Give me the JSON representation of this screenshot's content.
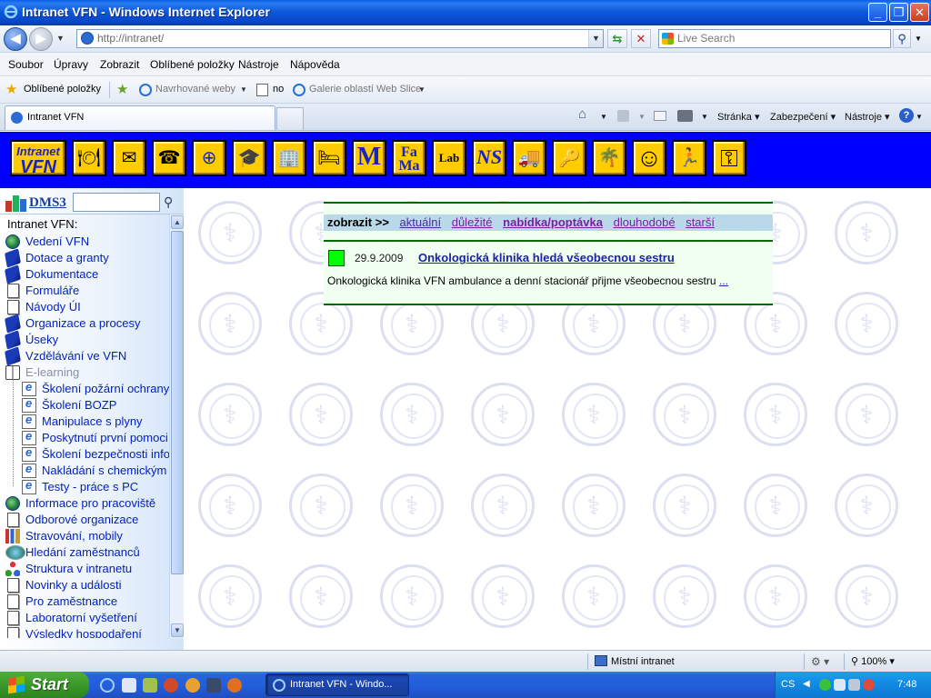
{
  "window": {
    "title": "Intranet VFN - Windows Internet Explorer"
  },
  "address": {
    "url": "http://intranet/",
    "search_placeholder": "Live Search"
  },
  "menu": [
    "Soubor",
    "Úpravy",
    "Zobrazit",
    "Oblíbené položky",
    "Nástroje",
    "Nápověda"
  ],
  "favorites": {
    "label": "Oblíbené položky",
    "suggested": "Navrhované weby",
    "no": "no",
    "gallery": "Galerie oblastí Web Slice"
  },
  "tab": {
    "label": "Intranet VFN"
  },
  "commands": {
    "page": "Stránka",
    "security": "Zabezpečení",
    "tools": "Nástroje"
  },
  "site": {
    "icon_buttons": [
      {
        "name": "intranet-vfn-logo",
        "icon": "logo-icon",
        "text_1": "Intranet",
        "text_2": "VFN"
      },
      {
        "name": "dining-button",
        "icon": "plate-icon",
        "glyph": "🍽"
      },
      {
        "name": "mail-button",
        "icon": "envelope-icon",
        "glyph": "✉"
      },
      {
        "name": "phone-button",
        "icon": "telephone-icon",
        "glyph": "☎"
      },
      {
        "name": "emblem-button",
        "icon": "emblem-icon",
        "glyph": "⊕"
      },
      {
        "name": "education-button",
        "icon": "graduation-cap-icon",
        "glyph": "🎓"
      },
      {
        "name": "building-button",
        "icon": "building-icon",
        "glyph": "🏢"
      },
      {
        "name": "bed-button",
        "icon": "bed-icon",
        "glyph": "🛏"
      },
      {
        "name": "m-button",
        "icon": "letter-m-icon",
        "glyph": "M"
      },
      {
        "name": "fama-button",
        "icon": "fama-icon",
        "glyph": "Fa\nMa"
      },
      {
        "name": "lab-button",
        "icon": "lab-icon",
        "glyph": "Lab"
      },
      {
        "name": "ns-button",
        "icon": "ns-icon",
        "glyph": "NS"
      },
      {
        "name": "truck-button",
        "icon": "truck-icon",
        "glyph": "🚚"
      },
      {
        "name": "keycard-button",
        "icon": "key-card-icon",
        "glyph": "🔑"
      },
      {
        "name": "holiday-button",
        "icon": "palm-tree-icon",
        "glyph": "🌴"
      },
      {
        "name": "smiley-button",
        "icon": "smiley-icon",
        "glyph": "☺"
      },
      {
        "name": "safety-button",
        "icon": "falling-person-icon",
        "glyph": "🏃"
      },
      {
        "name": "key-button",
        "icon": "key-icon",
        "glyph": "⚿"
      }
    ],
    "dms": {
      "label": "DMS3"
    },
    "tree": {
      "header": "Intranet VFN:",
      "items": [
        {
          "label": "Vedení VFN",
          "icon": "globe"
        },
        {
          "label": "Dotace a granty",
          "icon": "book"
        },
        {
          "label": "Dokumentace",
          "icon": "book"
        },
        {
          "label": "Formuláře",
          "icon": "page"
        },
        {
          "label": "Návody ÚI",
          "icon": "page"
        },
        {
          "label": "Organizace a procesy",
          "icon": "book"
        },
        {
          "label": "Úseky",
          "icon": "book"
        },
        {
          "label": "Vzdělávání ve VFN",
          "icon": "book"
        },
        {
          "label": "E-learning",
          "icon": "open"
        },
        {
          "label": "Školení požární ochrany",
          "icon": "ie",
          "child": true
        },
        {
          "label": "Školení BOZP",
          "icon": "ie",
          "child": true
        },
        {
          "label": "Manipulace s plyny",
          "icon": "ie",
          "child": true
        },
        {
          "label": "Poskytnutí první pomoci",
          "icon": "ie",
          "child": true
        },
        {
          "label": "Školení bezpečnosti info",
          "icon": "ie",
          "child": true
        },
        {
          "label": "Nakládání s chemickým",
          "icon": "ie",
          "child": true
        },
        {
          "label": "Testy - práce s PC",
          "icon": "ie",
          "child": true
        },
        {
          "label": "Informace pro pracoviště",
          "icon": "globe"
        },
        {
          "label": "Odborové organizace",
          "icon": "page"
        },
        {
          "label": "Stravování, mobily",
          "icon": "food"
        },
        {
          "label": "Hledání zaměstnanců",
          "icon": "search"
        },
        {
          "label": "Struktura v intranetu",
          "icon": "net"
        },
        {
          "label": "Novinky a události",
          "icon": "page"
        },
        {
          "label": "Pro zaměstnance",
          "icon": "page"
        },
        {
          "label": "Laboratorní vyšetření",
          "icon": "page"
        },
        {
          "label": "Výsledky hospodaření",
          "icon": "page"
        }
      ]
    },
    "news": {
      "show_label": "zobrazit >>",
      "filters": [
        "aktuální",
        "důležité",
        "nabídka/poptávka",
        "dlouhodobé",
        "starší"
      ],
      "active_filter": "nabídka/poptávka",
      "item": {
        "date": "29.9.2009",
        "title": "Onkologická klinika hledá všeobecnou sestru",
        "description": "Onkologická klinika VFN ambulance a denní stacionář přijme všeobecnou sestru",
        "more": "..."
      }
    }
  },
  "status": {
    "zone": "Místní intranet",
    "zoom": "100%"
  },
  "taskbar": {
    "start": "Start",
    "task": "Intranet VFN - Windo...",
    "lang": "CS",
    "time": "7:48"
  }
}
